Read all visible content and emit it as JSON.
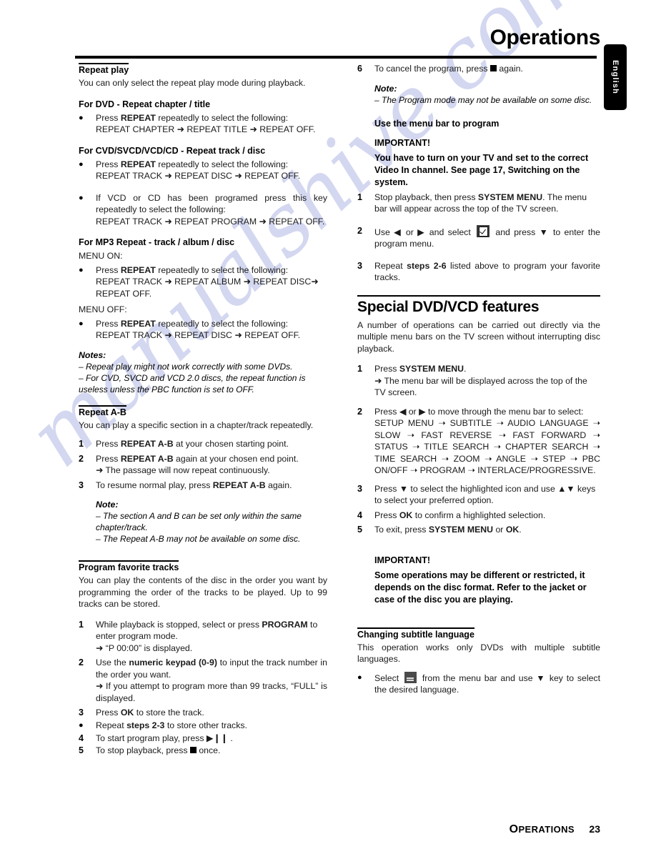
{
  "header": {
    "title": "Operations",
    "language_tab": "English"
  },
  "footer": {
    "section_first_letter": "O",
    "section_rest": "PERATIONS",
    "page_number": "23"
  },
  "watermark": {
    "text": "manualshive.com"
  },
  "left_column": {
    "repeat_play": {
      "title": "Repeat play",
      "intro": "You can only select the repeat play mode during playback.",
      "dvd_subhead": "For DVD - Repeat chapter / title",
      "dvd_bullet_line1_pre": "Press ",
      "dvd_bullet_line1_bold": "REPEAT",
      "dvd_bullet_line1_post": " repeatedly to select the following:",
      "dvd_sequence": "REPEAT CHAPTER ➜ REPEAT TITLE ➜ REPEAT OFF.",
      "cvd_subhead": "For CVD/SVCD/VCD/CD - Repeat track / disc",
      "cvd_bullet_line1_pre": "Press ",
      "cvd_bullet_line1_bold": "REPEAT",
      "cvd_bullet_line1_post": " repeatedly to select the following:",
      "cvd_sequence": "REPEAT TRACK ➜ REPEAT DISC ➜ REPEAT OFF.",
      "programed_bullet": "If VCD or CD has been programed press this key repeatedly to select the following:",
      "programed_sequence": "REPEAT TRACK ➜ REPEAT PROGRAM ➜  REPEAT OFF.",
      "mp3_subhead": "For MP3 Repeat - track / album / disc",
      "menu_on_label": "MENU ON:",
      "mp3_on_line_pre": "Press ",
      "mp3_on_line_bold": "REPEAT",
      "mp3_on_line_post": " repeatedly to select the following:",
      "mp3_on_sequence": "REPEAT TRACK ➜ REPEAT ALBUM ➜ REPEAT DISC➜ REPEAT OFF.",
      "menu_off_label": "MENU OFF:",
      "mp3_off_line_pre": "Press ",
      "mp3_off_line_bold": "REPEAT",
      "mp3_off_line_post": " repeatedly to select the following:",
      "mp3_off_sequence": "REPEAT TRACK ➜ REPEAT DISC ➜  REPEAT OFF.",
      "notes_title": "Notes:",
      "note1": "–  Repeat play might not work correctly with some DVDs.",
      "note2": "–  For CVD, SVCD and VCD 2.0 discs, the repeat function is useless unless the PBC function is set to OFF."
    },
    "repeat_ab": {
      "title": "Repeat A-B",
      "intro": "You can play a specific section in a chapter/track repeatedly.",
      "step1_num": "1",
      "step1_pre": "Press ",
      "step1_bold": "REPEAT A-B",
      "step1_post": " at your chosen starting point.",
      "step2_num": "2",
      "step2_pre": "Press ",
      "step2_bold": "REPEAT A-B",
      "step2_post": " again at your chosen end point.",
      "step2_arrow": "➜  The passage will now repeat continuously.",
      "step3_num": "3",
      "step3_pre": "To resume normal play, press ",
      "step3_bold": "REPEAT A-B",
      "step3_post": " again.",
      "note_title": "Note:",
      "note1": "–  The section A and B can be set only within the same chapter/track.",
      "note2": "–  The Repeat A-B may not be available on some disc."
    },
    "program_tracks": {
      "title": "Program favorite tracks",
      "intro": "You can play the contents of the disc in the order you want by programming the order of the tracks to be played. Up to 99 tracks can be stored.",
      "step1_num": "1",
      "step1_pre": "While playback is stopped, select or press ",
      "step1_bold": "PROGRAM",
      "step1_post": " to enter program mode.",
      "step1_arrow": "➜  “P 00:00” is displayed.",
      "step2_num": "2",
      "step2_pre": "Use the ",
      "step2_bold": "numeric keypad (0-9)",
      "step2_post": " to input the track number in the order you want.",
      "step2_arrow": "➜  If you attempt to program more than 99 tracks, “FULL” is displayed.",
      "step3_num": "3",
      "step3_pre": "Press ",
      "step3_bold": "OK",
      "step3_post": " to store the track.",
      "bullet_pre": "Repeat ",
      "bullet_bold": "steps 2-3",
      "bullet_post": " to store other tracks.",
      "step4_num": "4",
      "step4_text": "To start program play, press ▶❙❙ .",
      "step5_num": "5",
      "step5_pre": "To stop playback, press ",
      "step5_post": " once."
    }
  },
  "right_column": {
    "step6_num": "6",
    "step6_pre": "To cancel the program, press ",
    "step6_post": " again.",
    "note_title": "Note:",
    "note1": "–  The Program mode may not be available on some disc.",
    "menu_bar_subhead": "Use the menu bar to program",
    "important1_title": "IMPORTANT!",
    "important1_body": "You have to turn on your TV and set to the correct Video In channel. See page 17, Switching on the system.",
    "m_step1_num": "1",
    "m_step1_pre": "Stop playback, then press ",
    "m_step1_bold": "SYSTEM MENU",
    "m_step1_post": ". The menu bar will appear across the top of the TV screen.",
    "m_step2_num": "2",
    "m_step2_pre": "Use ◀ or ▶ and select ",
    "m_step2_post": " and press ▼ to enter the program menu.",
    "m_step3_num": "3",
    "m_step3_pre": " Repeat ",
    "m_step3_bold": "steps 2-6",
    "m_step3_post": " listed above to program your favorite tracks.",
    "special_heading": "Special DVD/VCD features",
    "special_intro": "A number of operations can be carried out directly via the multiple menu bars on the TV screen without interrupting disc playback.",
    "s_step1_num": "1",
    "s_step1_pre": "Press ",
    "s_step1_bold": "SYSTEM MENU",
    "s_step1_post": ".",
    "s_step1_arrow": "➜  The menu bar will be displayed across the top of the TV screen.",
    "s_step2_num": "2",
    "s_step2_text": "Press ◀ or ▶ to move through the menu bar to select:",
    "s_step2_sequence": "SETUP MENU ➝ SUBTITLE ➝ AUDIO LANGUAGE ➝ SLOW ➝ FAST REVERSE ➝ FAST FORWARD ➝ STATUS ➝ TITLE SEARCH ➝ CHAPTER SEARCH ➝ TIME SEARCH ➝ ZOOM ➝ ANGLE ➝ STEP ➝ PBC ON/OFF ➝ PROGRAM ➝ INTERLACE/PROGRESSIVE.",
    "s_step3_num": "3",
    "s_step3_text": "Press ▼ to select the highlighted icon and use ▲▼ keys to select your preferred option.",
    "s_step4_num": "4",
    "s_step4_pre": "Press ",
    "s_step4_bold": "OK",
    "s_step4_post": " to confirm a highlighted selection.",
    "s_step5_num": "5",
    "s_step5_pre": "To exit, press ",
    "s_step5_bold": "SYSTEM MENU",
    "s_step5_mid": " or ",
    "s_step5_bold2": "OK",
    "s_step5_post": ".",
    "important2_title": "IMPORTANT!",
    "important2_body": "Some operations may be different or restricted, it depends on the disc format. Refer to the jacket or case of the disc you are playing.",
    "subtitle_section_title": "Changing subtitle language",
    "subtitle_intro": "This operation works only DVDs with multiple subtitle languages.",
    "subtitle_bullet_pre": "Select ",
    "subtitle_bullet_post": " from the menu bar and use ▼ key to select the desired language."
  }
}
